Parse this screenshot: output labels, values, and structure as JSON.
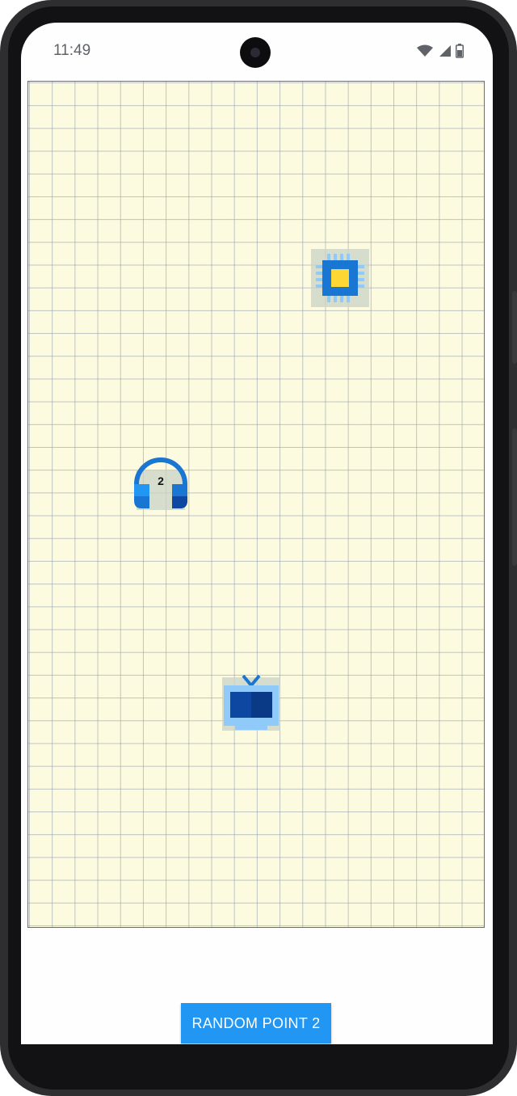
{
  "status_bar": {
    "time": "11:49",
    "icons": [
      "wifi-icon",
      "cellular-signal-icon",
      "battery-icon"
    ]
  },
  "grid": {
    "background_color": "#fcfbdf",
    "line_color": "#8c96aa"
  },
  "markers": [
    {
      "name": "cpu-chip-icon",
      "label": ""
    },
    {
      "name": "headphones-icon",
      "label": "2"
    },
    {
      "name": "tv-icon",
      "label": ""
    }
  ],
  "actions": {
    "random_point_label": "RANDOM POINT 2"
  },
  "colors": {
    "button": "#2196f3",
    "icon_blue": "#1976d2",
    "icon_dark_blue": "#0d47a1",
    "icon_light_blue": "#90caf9",
    "chip_core": "#fdd835"
  }
}
